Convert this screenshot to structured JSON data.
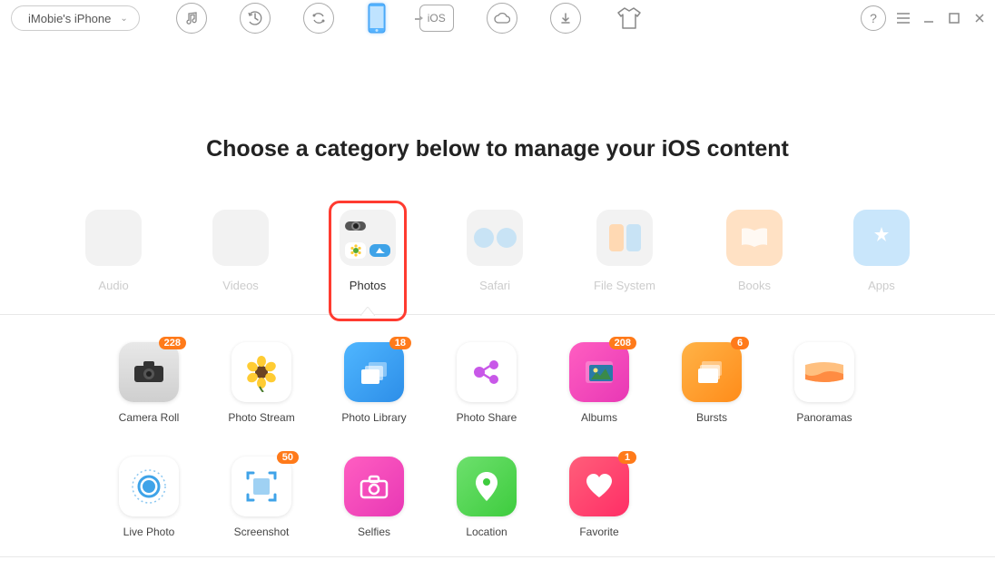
{
  "device": {
    "name": "iMobie's iPhone"
  },
  "heading": "Choose a category below to manage your iOS content",
  "categories": [
    {
      "label": "Audio"
    },
    {
      "label": "Videos"
    },
    {
      "label": "Photos"
    },
    {
      "label": "Safari"
    },
    {
      "label": "File System"
    },
    {
      "label": "Books"
    },
    {
      "label": "Apps"
    }
  ],
  "subcategories": [
    {
      "label": "Camera Roll",
      "badge": "228"
    },
    {
      "label": "Photo Stream",
      "badge": ""
    },
    {
      "label": "Photo Library",
      "badge": "18"
    },
    {
      "label": "Photo Share",
      "badge": ""
    },
    {
      "label": "Albums",
      "badge": "208"
    },
    {
      "label": "Bursts",
      "badge": "6"
    },
    {
      "label": "Panoramas",
      "badge": ""
    },
    {
      "label": "Live Photo",
      "badge": ""
    },
    {
      "label": "Screenshot",
      "badge": "50"
    },
    {
      "label": "Selfies",
      "badge": ""
    },
    {
      "label": "Location",
      "badge": ""
    },
    {
      "label": "Favorite",
      "badge": "1"
    }
  ],
  "toolbar_ios": "iOS"
}
